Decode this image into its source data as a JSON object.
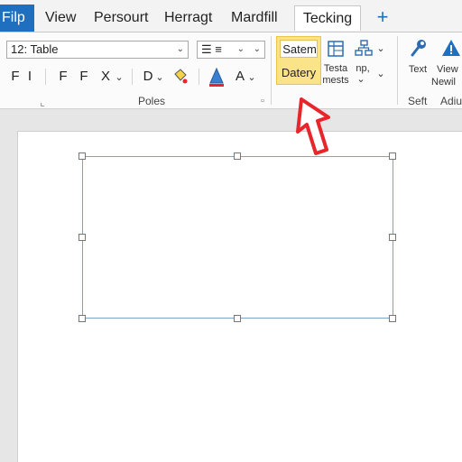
{
  "tabs": {
    "file": "Filp",
    "view": "View",
    "persourt": "Persourt",
    "herragt": "Herragt",
    "mardfill": "Mardfill",
    "tecking": "Tecking",
    "add": "+"
  },
  "ribbon": {
    "style_combo": "12: Table",
    "list_combo": "☰ ≡",
    "row2_f1": "F",
    "row2_i": "I",
    "row2_f2": "F",
    "row2_f3": "F",
    "row2_x": "X",
    "row2_d": "D",
    "row2_a": "A",
    "groups": {
      "poles": "Poles",
      "seft": "Seft",
      "adiu": "Adiu"
    },
    "satem": "Satem",
    "datery": "Datery",
    "testa_line1": "Testa",
    "testa_line2": "mests",
    "np": "np,",
    "text": "Text",
    "view_line1": "View",
    "view_line2": "Newil",
    "accent_blue": "#1e6fc0",
    "highlight": "#fbe38a",
    "pointer_red": "#e8252b"
  },
  "icons": [
    "dropdown-arrow-icon",
    "dialog-launcher-icon",
    "table-icon",
    "sitemap-icon",
    "chevron-down-icon",
    "wrench-icon",
    "warning-icon",
    "paint-bucket-icon",
    "font-color-icon",
    "pointer-arrow-icon"
  ]
}
